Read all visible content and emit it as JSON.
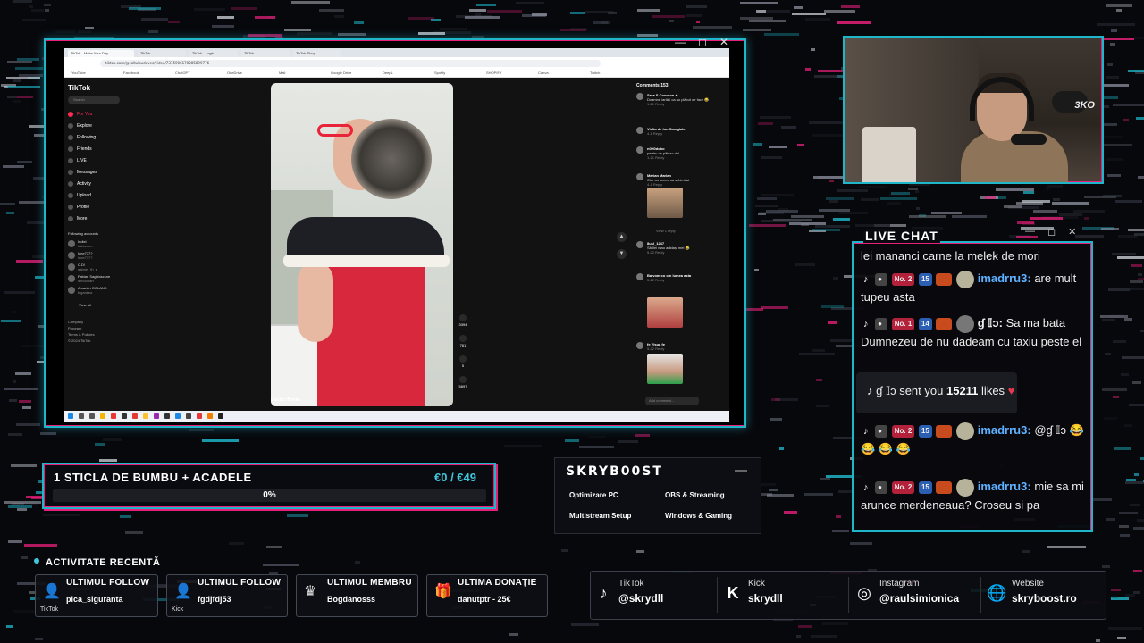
{
  "capture": {
    "window_controls": [
      "—",
      "◻",
      "✕"
    ],
    "browser_tabs": [
      "TikTok - Make Your Day",
      "TikTok",
      "TikTok - Login",
      "TikTok",
      "TikTok Shop"
    ],
    "address": "tiktok.com/@coltulsuduvec/video/7375906170285899776",
    "bookmarks": [
      "YouTube",
      "Facebook",
      "ChatGPT",
      "OneDrive",
      "Mail",
      "Google Drive",
      "DeepL",
      "Spotify",
      "SHOPIFY",
      "Canva",
      "Twitch"
    ],
    "tiktok": {
      "logo": "TikTok",
      "search_placeholder": "Search",
      "nav": [
        "For You",
        "Explore",
        "Following",
        "Friends",
        "LIVE",
        "Messages",
        "Activity",
        "Upload",
        "Profile",
        "More"
      ],
      "following_header": "Following accounts",
      "accounts": [
        {
          "name": "Indiei",
          "handle": "kabarsen"
        },
        {
          "name": "lone777?",
          "handle": "lone777?"
        },
        {
          "name": "C.D!",
          "handle": "gabriel_fh_e"
        },
        {
          "name": "Fabian Sagbioscsne",
          "handle": "djmoonart"
        },
        {
          "name": "Amarkin OGLAND",
          "handle": "bigardaw"
        }
      ],
      "view_all": "View all",
      "footer": [
        "Company",
        "Program",
        "Terms & Policies",
        "© 2024 TikTok"
      ],
      "video_caption": "Dosbi.t Boyka",
      "actions": [
        "3394",
        "761",
        "5",
        "5697"
      ],
      "comments_title": "Comments 153",
      "comments": [
        {
          "user": "Sara S Coordon ✦",
          "text": "Doamne iartă-i ca au plăcut oe face 😂",
          "meta": "1-21  Reply"
        },
        {
          "user": "Viclta de lon Caragiale",
          "text": "",
          "meta": "4-1  Reply"
        },
        {
          "user": "n0H0dobo",
          "text": "pentru ce pătesc doi",
          "meta": "1-21  Reply"
        },
        {
          "user": "Marian Marian",
          "text": "Cior ca lumea sa schimbat",
          "meta": "4-1  Reply"
        },
        {
          "user": "8usl_1247",
          "text": "Să îlei mau adidași mei 😂",
          "meta": "5-22  Reply"
        },
        {
          "user": "Ba vom co om lumea asta",
          "text": "",
          "meta": "5-22  Reply"
        },
        {
          "user": "fe Ylsua fe",
          "text": "",
          "meta": "5-22  Reply"
        }
      ],
      "view_reply": "View 1 reply",
      "add_comment": "Add comment..."
    }
  },
  "webcam": {
    "logo": "3KO"
  },
  "chat": {
    "title": "LIVE CHAT",
    "controls": [
      "—",
      "◻",
      "✕"
    ],
    "first_line": "lei mananci carne la melek de mori",
    "messages": [
      {
        "rank": "No. 2",
        "level": "15",
        "user": "imadrru3:",
        "text": "are mult tupeu asta"
      },
      {
        "rank": "No. 1",
        "level": "14",
        "user": "ɠ 𝕀ᴐ:",
        "text": "Sa ma bata Dumnezeu de nu dadeam cu taxiu peste el"
      },
      {
        "rank": "No. 2",
        "level": "15",
        "user": "imadrru3:",
        "text": "@ɠ 𝕀ᴐ 😂 😂 😂 😂"
      },
      {
        "rank": "No. 2",
        "level": "15",
        "user": "imadrru3:",
        "text": "mie sa mi arunce merdeneaua? Croseu si pa"
      }
    ],
    "gift": {
      "user": "ɠ 𝕀ᴐ",
      "verb": "sent you",
      "amount": "15211",
      "unit": "likes",
      "icon": "♥"
    }
  },
  "goal": {
    "title": "1 STICLA DE BUMBU + ACADELE",
    "amount": "€0 / €49",
    "percent_label": "0%",
    "progress": 0.0
  },
  "sponsor": {
    "logo": "SKRYB00ST",
    "items": [
      "Optimizare PC",
      "OBS & Streaming",
      "Multistream Setup",
      "Windows & Gaming"
    ]
  },
  "recent": {
    "title": "ACTIVITATE RECENTĂ",
    "cards": [
      {
        "label": "ULTIMUL FOLLOW",
        "value": "pica_siguranta",
        "platform": "TikTok",
        "icon": "user-plus-icon"
      },
      {
        "label": "ULTIMUL FOLLOW",
        "value": "fgdjfdj53",
        "platform": "Kick",
        "icon": "user-plus-icon"
      },
      {
        "label": "ULTIMUL MEMBRU",
        "value": "Bogdanosss",
        "platform": "",
        "icon": "crown-icon"
      },
      {
        "label": "ULTIMA DONAȚIE",
        "value": "danutptr - 25€",
        "platform": "",
        "icon": "gift-icon"
      }
    ]
  },
  "socials": [
    {
      "network": "TikTok",
      "handle": "@skrydll",
      "icon": "tiktok-icon"
    },
    {
      "network": "Kick",
      "handle": "skrydll",
      "icon": "kick-icon"
    },
    {
      "network": "Instagram",
      "handle": "@raulsimionica",
      "icon": "instagram-icon"
    },
    {
      "network": "Website",
      "handle": "skryboost.ro",
      "icon": "globe-icon"
    }
  ],
  "colors": {
    "accent_cyan": "#1fb6c9",
    "accent_pink": "#e8207b",
    "tiktok_red": "#fe2c55",
    "chat_user": "#5fb0ff"
  }
}
